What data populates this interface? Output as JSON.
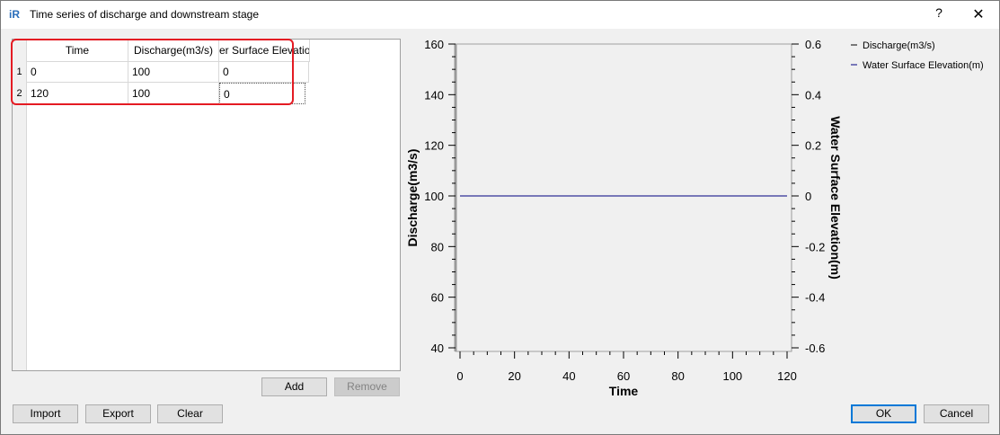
{
  "window": {
    "title": "Time series of discharge and downstream stage",
    "help_label": "?",
    "close_label": "✕",
    "app_icon": "iR"
  },
  "table": {
    "columns": [
      "Time",
      "Discharge(m3/s)",
      "er Surface Elevatio"
    ],
    "row_numbers": [
      "1",
      "2"
    ],
    "rows": [
      [
        "0",
        "100",
        "0"
      ],
      [
        "120",
        "100",
        "0"
      ]
    ]
  },
  "buttons": {
    "add": "Add",
    "remove": "Remove",
    "import": "Import",
    "export": "Export",
    "clear": "Clear",
    "ok": "OK",
    "cancel": "Cancel"
  },
  "colors": {
    "highlight": "#e41b23",
    "discharge_series": "#000000",
    "wse_series": "#000080",
    "plot_bg": "#f0f0f0"
  },
  "chart_data": {
    "type": "line",
    "xlabel": "Time",
    "ylabel": "Discharge(m3/s)",
    "y2label": "Water Surface Elevation(m)",
    "xlim": [
      0,
      120
    ],
    "ylim": [
      40,
      160
    ],
    "y2lim": [
      -0.6,
      0.6
    ],
    "x_ticks": [
      "0",
      "20",
      "40",
      "60",
      "80",
      "100",
      "120"
    ],
    "y_ticks": [
      "40",
      "60",
      "80",
      "100",
      "120",
      "140",
      "160"
    ],
    "y2_ticks": [
      "-0.6",
      "-0.4",
      "-0.2",
      "0",
      "0.2",
      "0.4",
      "0.6"
    ],
    "legend_position": "top-right",
    "series": [
      {
        "name": "Discharge(m3/s)",
        "axis": "left",
        "color": "#000000",
        "x": [
          0,
          120
        ],
        "y": [
          100,
          100
        ]
      },
      {
        "name": "Water Surface Elevation(m)",
        "axis": "right",
        "color": "#000080",
        "x": [
          0,
          120
        ],
        "y": [
          0,
          0
        ]
      }
    ]
  }
}
